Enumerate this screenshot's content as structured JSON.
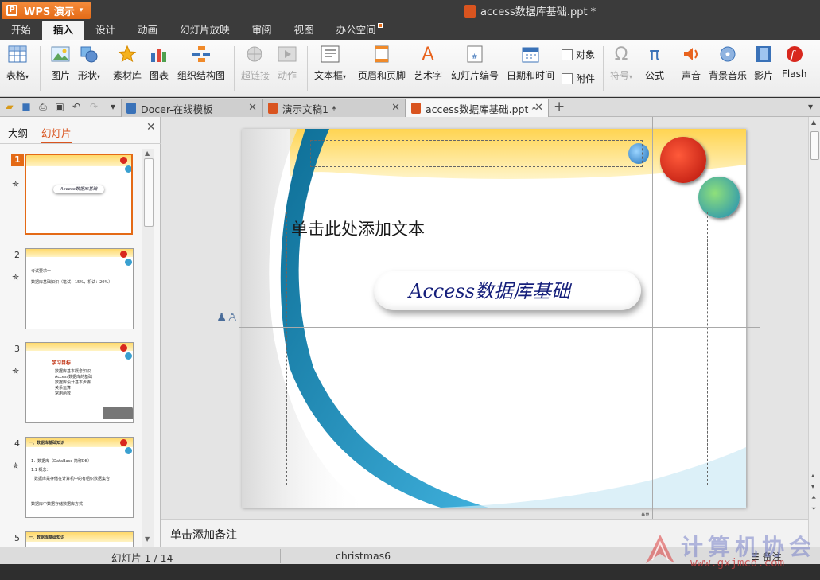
{
  "app": {
    "name": "WPS 演示",
    "logo_glyph": "P",
    "caret": "▾"
  },
  "window": {
    "title": "access数据库基础.ppt *"
  },
  "menu": [
    {
      "label": "开始"
    },
    {
      "label": "插入"
    },
    {
      "label": "设计"
    },
    {
      "label": "动画"
    },
    {
      "label": "幻灯片放映"
    },
    {
      "label": "审阅"
    },
    {
      "label": "视图"
    },
    {
      "label": "办公空间"
    }
  ],
  "active_menu": "插入",
  "ribbon": {
    "table": "表格",
    "picture": "图片",
    "shape": "形状",
    "clipart": "素材库",
    "chart": "图表",
    "orgchart": "组织结构图",
    "hyperlink": "超链接",
    "action": "动作",
    "textbox": "文本框",
    "header_footer": "页眉和页脚",
    "wordart": "艺术字",
    "slide_number": "幻灯片编号",
    "datetime": "日期和时间",
    "object": "对象",
    "attachment": "附件",
    "symbol": "符号",
    "formula": "公式",
    "sound": "声音",
    "bg_music": "背景音乐",
    "movie": "影片",
    "flash": "Flash",
    "dropdown_caret": "▾"
  },
  "quick_access": {
    "open": "📂",
    "save": "💾",
    "print": "⎙",
    "preview": "🔍",
    "undo": "↶",
    "redo": "↷",
    "more": "▾"
  },
  "tabs": [
    {
      "label": "Docer-在线模板",
      "close": "✕"
    },
    {
      "label": "演示文稿1 *",
      "close": "✕"
    },
    {
      "label": "access数据库基础.ppt *",
      "close": "✕"
    }
  ],
  "add_tab": "+",
  "left_panel": {
    "tab_outline": "大纲",
    "tab_slides": "幻灯片",
    "close": "✕",
    "slides": [
      {
        "num": "1",
        "star": "✯",
        "title": "Access数据库基础"
      },
      {
        "num": "2",
        "star": "✯",
        "line1": "考试要求一",
        "line2": "数据库基础知识（笔试：15%，机试：20%）"
      },
      {
        "num": "3",
        "star": "✯",
        "heading": "学习目标",
        "bullets": [
          "数据库基本概念知识",
          "Access数据库的基础",
          "数据库设计基本步骤",
          "关系运算",
          "常用函数"
        ]
      },
      {
        "num": "4",
        "star": "✯",
        "heading": "一、数据库基础知识",
        "line1": "1．数据库（DataBase 简称DB）",
        "line2": "1.1 概念：",
        "line3": "数据库是存储在计算机中的有组织数据集合",
        "line4": "数据库中数据存储数据库方式"
      },
      {
        "num": "5",
        "heading": "一、数据库基础知识"
      }
    ]
  },
  "slide": {
    "placeholder_hint": "单击此处添加文本",
    "title": "Access数据库基础"
  },
  "notes": {
    "placeholder": "单击添加备注"
  },
  "status": {
    "slide_counter": "幻灯片 1 / 14",
    "theme": "christmas6",
    "notes_button": "备注"
  },
  "watermark": {
    "text": "计算机协会",
    "url": "www.gxjmcd.com"
  },
  "colors": {
    "accent": "#e46a16",
    "title_text": "#141e7a",
    "wave_blue": "#2b8bb0",
    "band_yellow": "#ffd96a"
  }
}
